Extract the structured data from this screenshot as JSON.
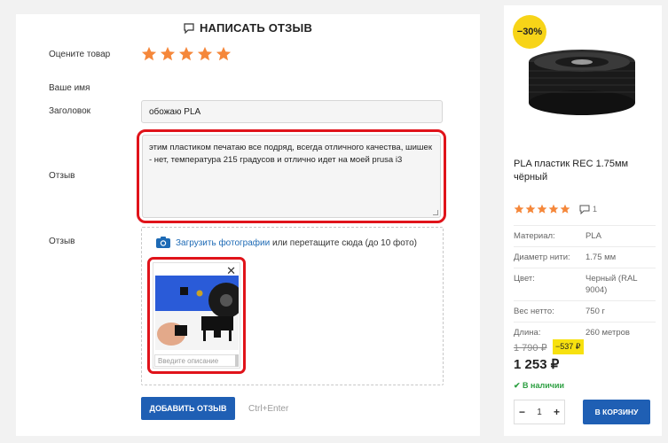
{
  "review_form": {
    "title": "НАПИСАТЬ ОТЗЫВ",
    "rating_label": "Оцените товар",
    "rating_value": 5,
    "rating_max": 5,
    "name_label": "Ваше имя",
    "title_label": "Заголовок",
    "title_value": "обожаю PLA",
    "review_label": "Отзыв",
    "review_text": "этим пластиком печатаю все подряд, всегда отличного качества, шишек - нет, температура 215 градусов и отлично идет на моей prusa i3",
    "photo_label": "Отзыв",
    "upload_link": "Загрузить фотографии",
    "upload_hint": " или перетащите сюда (до 10 фото)",
    "photo_description_placeholder": "Введите описание",
    "submit_label": "ДОБАВИТЬ ОТЗЫВ",
    "submit_shortcut": "Ctrl+Enter"
  },
  "product": {
    "discount": "−30%",
    "name": "PLA пластик REC 1.75мм чёрный",
    "rating_value": 5,
    "comments_count": "1",
    "specs": [
      {
        "key": "Материал:",
        "value": "PLA"
      },
      {
        "key": "Диаметр нити:",
        "value": "1.75 мм"
      },
      {
        "key": "Цвет:",
        "value": "Черный (RAL 9004)"
      },
      {
        "key": "Вес нетто:",
        "value": "750 г"
      },
      {
        "key": "Длина:",
        "value": "260 метров"
      }
    ],
    "old_price": "1 790 ₽",
    "price_diff": "−537 ₽",
    "price": "1 253 ₽",
    "stock": "✔ В наличии",
    "quantity": "1",
    "qty_minus": "−",
    "qty_plus": "+",
    "cart_label": "В КОРЗИНУ"
  },
  "colors": {
    "accent_blue": "#1f5fb4",
    "star_orange": "#f5873a",
    "highlight_red": "#e0131a",
    "badge_yellow": "#f7d418",
    "stock_green": "#2ea043"
  }
}
